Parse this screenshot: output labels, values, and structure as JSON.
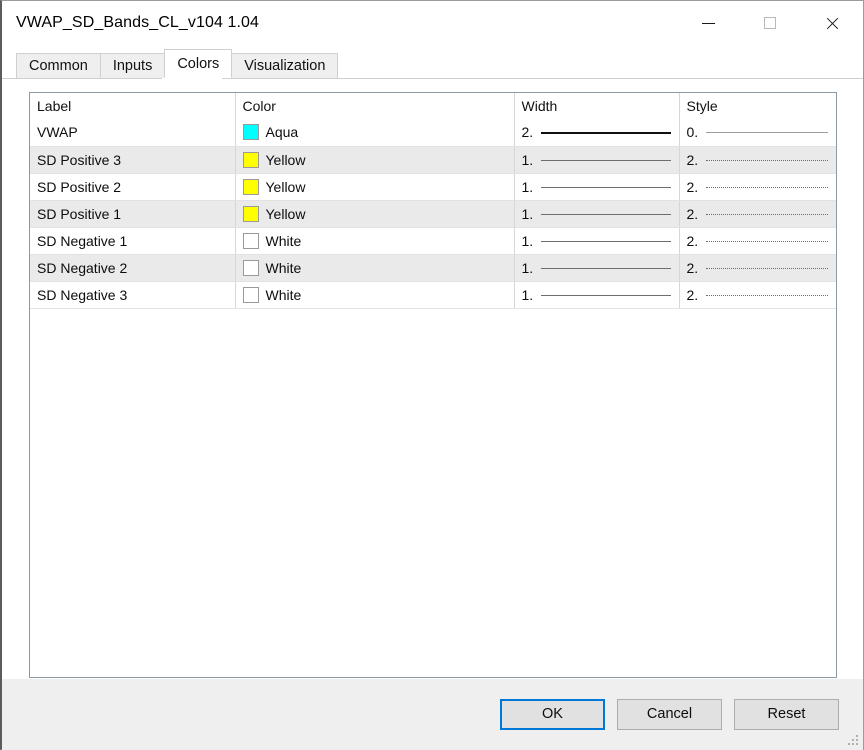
{
  "window": {
    "title": "VWAP_SD_Bands_CL_v104 1.04",
    "controls": {
      "minimize": "—",
      "maximize": "□",
      "close": "✕"
    }
  },
  "tabs": [
    {
      "label": "Common",
      "active": false
    },
    {
      "label": "Inputs",
      "active": false
    },
    {
      "label": "Colors",
      "active": true
    },
    {
      "label": "Visualization",
      "active": false
    }
  ],
  "grid": {
    "headers": [
      "Label",
      "Color",
      "Width",
      "Style"
    ],
    "rows": [
      {
        "label": "VWAP",
        "color_name": "Aqua",
        "color_hex": "#00FFFF",
        "width_value": "2.",
        "width_preview": "thick-solid",
        "style_value": "0.",
        "style_preview": "solid"
      },
      {
        "label": "SD Positive 3",
        "color_name": "Yellow",
        "color_hex": "#FFFF00",
        "width_value": "1.",
        "width_preview": "thin-solid",
        "style_value": "2.",
        "style_preview": "dotted"
      },
      {
        "label": "SD Positive 2",
        "color_name": "Yellow",
        "color_hex": "#FFFF00",
        "width_value": "1.",
        "width_preview": "thin-solid",
        "style_value": "2.",
        "style_preview": "dotted"
      },
      {
        "label": "SD Positive 1",
        "color_name": "Yellow",
        "color_hex": "#FFFF00",
        "width_value": "1.",
        "width_preview": "thin-solid",
        "style_value": "2.",
        "style_preview": "dotted"
      },
      {
        "label": "SD Negative 1",
        "color_name": "White",
        "color_hex": "#FFFFFF",
        "width_value": "1.",
        "width_preview": "thin-solid",
        "style_value": "2.",
        "style_preview": "dotted"
      },
      {
        "label": "SD Negative 2",
        "color_name": "White",
        "color_hex": "#FFFFFF",
        "width_value": "1.",
        "width_preview": "thin-solid",
        "style_value": "2.",
        "style_preview": "dotted"
      },
      {
        "label": "SD Negative 3",
        "color_name": "White",
        "color_hex": "#FFFFFF",
        "width_value": "1.",
        "width_preview": "thin-solid",
        "style_value": "2.",
        "style_preview": "dotted"
      }
    ]
  },
  "footer": {
    "ok_label": "OK",
    "cancel_label": "Cancel",
    "reset_label": "Reset"
  },
  "theme": {
    "accent": "#0078D7",
    "row_stripe": "#EAEAEA",
    "grid_border": "#8D9AA6",
    "footer_bg": "#EFEFEF"
  }
}
